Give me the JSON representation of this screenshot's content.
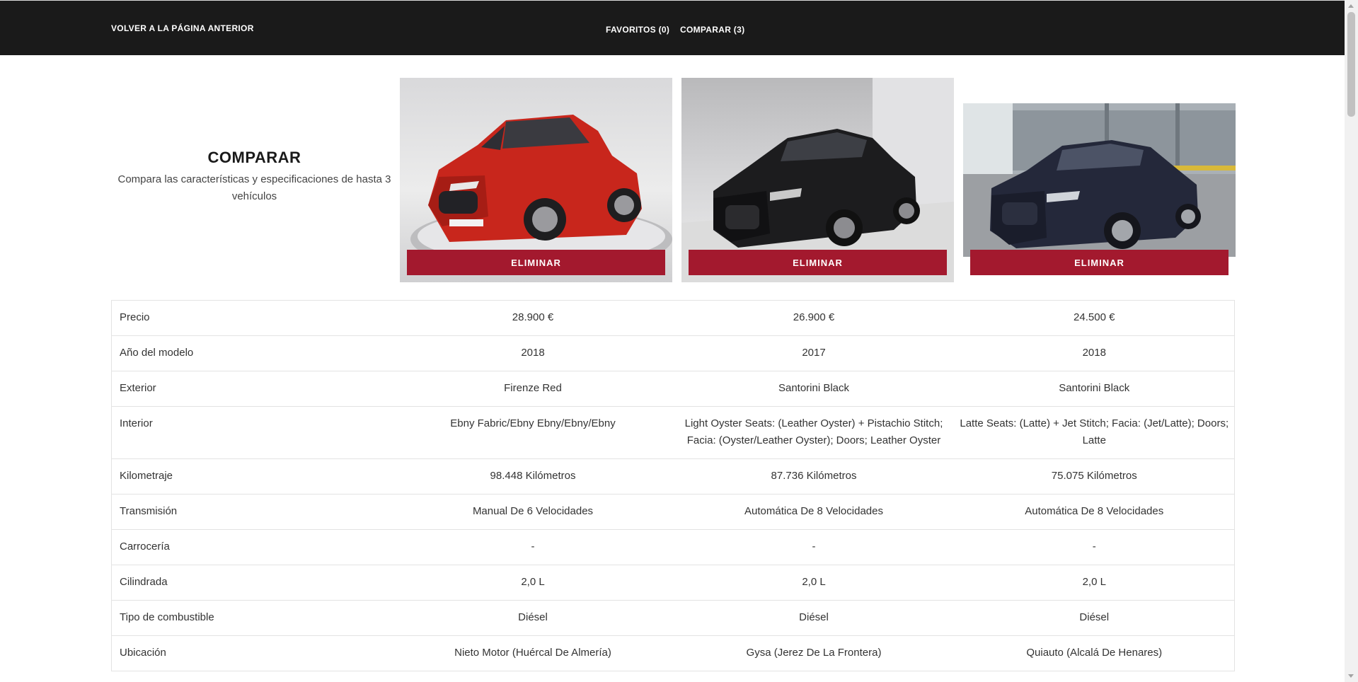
{
  "header": {
    "back_label": "VOLVER A LA PÁGINA ANTERIOR",
    "favorites_label": "FAVORITOS (0)",
    "compare_label": "COMPARAR (3)"
  },
  "intro": {
    "title": "COMPARAR",
    "subtitle": "Compara las características y especificaciones de hasta 3 vehículos"
  },
  "cars": [
    {
      "remove_label": "ELIMINAR",
      "photo_icon": "red-suv-photo"
    },
    {
      "remove_label": "ELIMINAR",
      "photo_icon": "black-sedan-photo"
    },
    {
      "remove_label": "ELIMINAR",
      "photo_icon": "dark-blue-sedan-photo"
    }
  ],
  "colors": {
    "header_bg": "#1a1a1a",
    "button_red": "#a3192e",
    "red_car": "#c8261c",
    "black_car": "#1c1c1e",
    "blue_car": "#24283a"
  },
  "specs": [
    {
      "label": "Precio",
      "values": [
        "28.900 €",
        "26.900 €",
        "24.500 €"
      ]
    },
    {
      "label": "Año del modelo",
      "values": [
        "2018",
        "2017",
        "2018"
      ]
    },
    {
      "label": "Exterior",
      "values": [
        "Firenze Red",
        "Santorini Black",
        "Santorini Black"
      ]
    },
    {
      "label": "Interior",
      "values": [
        "Ebny Fabric/Ebny Ebny/Ebny/Ebny",
        "Light Oyster Seats: (Leather Oyster) + Pistachio Stitch; Facia: (Oyster/Leather Oyster); Doors; Leather Oyster",
        "Latte Seats: (Latte) + Jet Stitch; Facia: (Jet/Latte); Doors; Latte"
      ]
    },
    {
      "label": "Kilometraje",
      "values": [
        "98.448 Kilómetros",
        "87.736 Kilómetros",
        "75.075 Kilómetros"
      ]
    },
    {
      "label": "Transmisión",
      "values": [
        "Manual De 6 Velocidades",
        "Automática De 8 Velocidades",
        "Automática De 8 Velocidades"
      ]
    },
    {
      "label": "Carrocería",
      "values": [
        "-",
        "-",
        "-"
      ]
    },
    {
      "label": "Cilindrada",
      "values": [
        "2,0 L",
        "2,0 L",
        "2,0 L"
      ]
    },
    {
      "label": "Tipo de combustible",
      "values": [
        "Diésel",
        "Diésel",
        "Diésel"
      ]
    },
    {
      "label": "Ubicación",
      "values": [
        "Nieto Motor (Huércal De Almería)",
        "Gysa (Jerez De La Frontera)",
        "Quiauto (Alcalá De Henares)"
      ]
    }
  ]
}
